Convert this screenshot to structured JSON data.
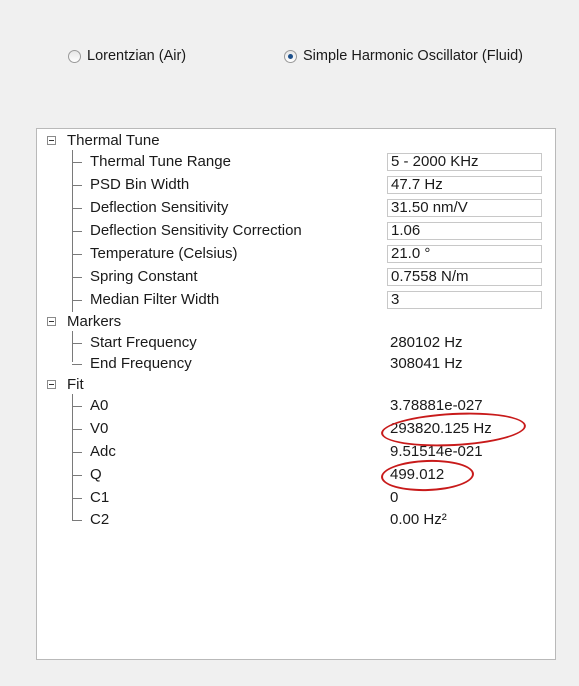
{
  "radio_options": [
    {
      "label": "Lorentzian (Air)",
      "checked": false
    },
    {
      "label": "Simple Harmonic Oscillator (Fluid)",
      "checked": true
    }
  ],
  "categories": [
    {
      "label": "Thermal Tune",
      "items": [
        {
          "label": "Thermal Tune Range",
          "value": "5 - 2000 KHz",
          "editable": true
        },
        {
          "label": "PSD Bin Width",
          "value": "47.7 Hz",
          "editable": true
        },
        {
          "label": "Deflection Sensitivity",
          "value": "31.50 nm/V",
          "editable": true
        },
        {
          "label": "Deflection Sensitivity Correction",
          "value": "1.06",
          "editable": true
        },
        {
          "label": "Temperature (Celsius)",
          "value": "21.0 °",
          "editable": true
        },
        {
          "label": "Spring Constant",
          "value": "0.7558 N/m",
          "editable": true
        },
        {
          "label": "Median Filter Width",
          "value": "3",
          "editable": true
        }
      ]
    },
    {
      "label": "Markers",
      "items": [
        {
          "label": "Start Frequency",
          "value": "280102 Hz",
          "editable": false
        },
        {
          "label": "End Frequency",
          "value": "308041 Hz",
          "editable": false
        }
      ]
    },
    {
      "label": "Fit",
      "items": [
        {
          "label": "A0",
          "value": "3.78881e-027",
          "editable": false
        },
        {
          "label": "V0",
          "value": "293820.125 Hz",
          "editable": false
        },
        {
          "label": "Adc",
          "value": "9.51514e-021",
          "editable": false
        },
        {
          "label": "Q",
          "value": "499.012",
          "editable": false
        },
        {
          "label": "C1",
          "value": "0",
          "editable": false
        },
        {
          "label": "C2",
          "value": "0.00 Hz²",
          "editable": false
        }
      ]
    }
  ],
  "annotation_color": "#c81a1a"
}
